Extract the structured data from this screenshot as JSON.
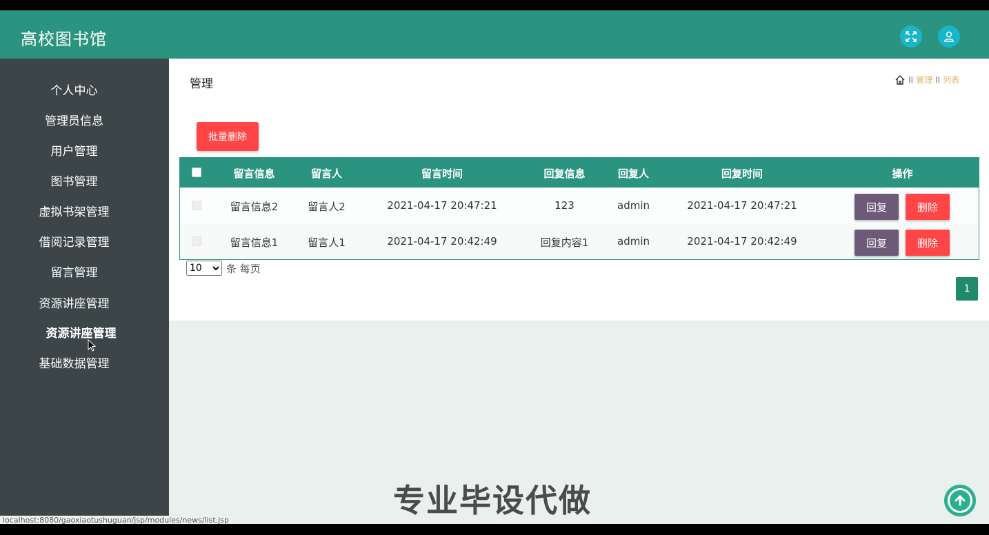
{
  "header": {
    "title": "高校图书馆",
    "fullscreen_icon": "expand-icon",
    "user_icon": "user-icon",
    "accent_color": "#2b9480"
  },
  "sidebar": {
    "items": [
      {
        "label": "个人中心"
      },
      {
        "label": "管理员信息"
      },
      {
        "label": "用户管理"
      },
      {
        "label": "图书管理"
      },
      {
        "label": "虚拟书架管理"
      },
      {
        "label": "借阅记录管理"
      },
      {
        "label": "留言管理"
      },
      {
        "label": "资源讲座管理"
      },
      {
        "label": "资源讲座管理"
      },
      {
        "label": "基础数据管理"
      }
    ]
  },
  "main": {
    "page_title": "管理",
    "breadcrumb": {
      "home_icon": "home-icon",
      "sep": "II",
      "item1": "管理",
      "item2": "列表"
    },
    "batch_delete": "批量删除",
    "table": {
      "columns": [
        "留言信息",
        "留言人",
        "留言时间",
        "回复信息",
        "回复人",
        "回复时间",
        "操作"
      ],
      "rows": [
        {
          "message": "留言信息2",
          "author": "留言人2",
          "time": "2021-04-17 20:47:21",
          "reply": "123",
          "replier": "admin",
          "reply_time": "2021-04-17 20:47:21"
        },
        {
          "message": "留言信息1",
          "author": "留言人1",
          "time": "2021-04-17 20:42:49",
          "reply": "回复内容1",
          "replier": "admin",
          "reply_time": "2021-04-17 20:42:49"
        }
      ],
      "reply_label": "回复",
      "delete_label": "删除"
    },
    "page_size": "10",
    "page_size_suffix": "条 每页",
    "current_page": "1"
  },
  "watermark": "专业毕设代做",
  "status_url": "localhost:8080/gaoxiaotushuguan/jsp/modules/news/list.jsp"
}
